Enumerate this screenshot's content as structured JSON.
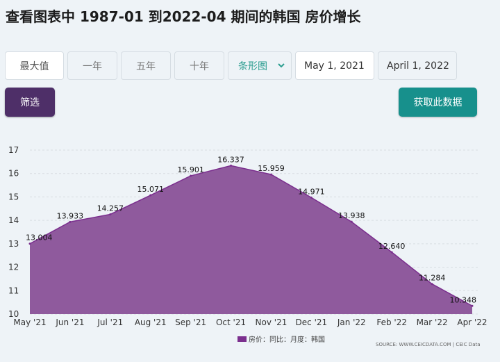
{
  "page": {
    "title": "查看图表中 1987-01 到2022-04 期间的韩国 房价增长"
  },
  "controls": {
    "range_buttons": [
      "最大值",
      "一年",
      "五年",
      "十年"
    ],
    "chart_type_select": "条形图",
    "date_from": "May 1, 2021",
    "date_to": "April 1, 2022",
    "filter_label": "筛选",
    "get_data_label": "获取此数据"
  },
  "colors": {
    "series_fill": "#8f5a9d",
    "series_line": "#7b2f8e",
    "primary_button": "#4e2f68",
    "accent_button": "#17908c"
  },
  "chart_data": {
    "type": "area",
    "categories": [
      "May '21",
      "Jun '21",
      "Jul '21",
      "Aug '21",
      "Sep '21",
      "Oct '21",
      "Nov '21",
      "Dec '21",
      "Jan '22",
      "Feb '22",
      "Mar '22",
      "Apr '22"
    ],
    "series": [
      {
        "name": "房价：同比：月度：韩国",
        "values": [
          13.004,
          13.933,
          14.257,
          15.071,
          15.901,
          16.337,
          15.959,
          14.971,
          13.938,
          12.64,
          11.284,
          10.348
        ]
      }
    ],
    "labels": [
      "13.004",
      "13.933",
      "14.257",
      "15.071",
      "15.901",
      "16.337",
      "15.959",
      "14.971",
      "13.938",
      "12.640",
      "11.284",
      "10.348"
    ],
    "ylim": [
      10,
      17
    ],
    "yticks": [
      "10",
      "11",
      "12",
      "13",
      "14",
      "15",
      "16",
      "17"
    ],
    "grid": true,
    "legend_position": "bottom",
    "source": "SOURCE: WWW.CEICDATA.COM | CEIC Data"
  }
}
